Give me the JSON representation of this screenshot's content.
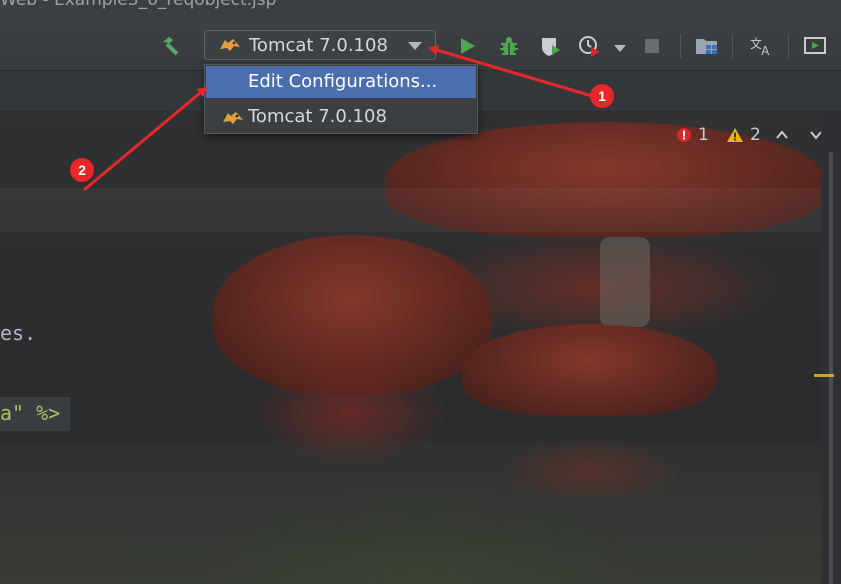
{
  "window": {
    "title": "Web - Example3_6_reqobject.jsp"
  },
  "toolbar": {
    "run_config_label": "Tomcat 7.0.108",
    "icons": [
      "build-hammer-icon",
      "run-icon",
      "debug-icon",
      "coverage-icon",
      "profile-icon",
      "stop-icon",
      "project-structure-icon",
      "translate-icon",
      "presentation-icon"
    ]
  },
  "dropdown": {
    "items": [
      {
        "label": "Edit Configurations...",
        "selected": true
      },
      {
        "label": "Tomcat 7.0.108",
        "selected": false
      }
    ]
  },
  "inspections": {
    "errors": "1",
    "warnings": "2"
  },
  "editor": {
    "line_fragment_1": "es.",
    "line_fragment_2": "a\" %>"
  },
  "annotations": {
    "badge_1": "1",
    "badge_2": "2"
  },
  "colors": {
    "selection": "#4b6eaf",
    "annotation_red": "#e8272a",
    "run_green": "#4fa64f",
    "error_red": "#d9262b",
    "warning_yellow": "#e3b41f"
  }
}
